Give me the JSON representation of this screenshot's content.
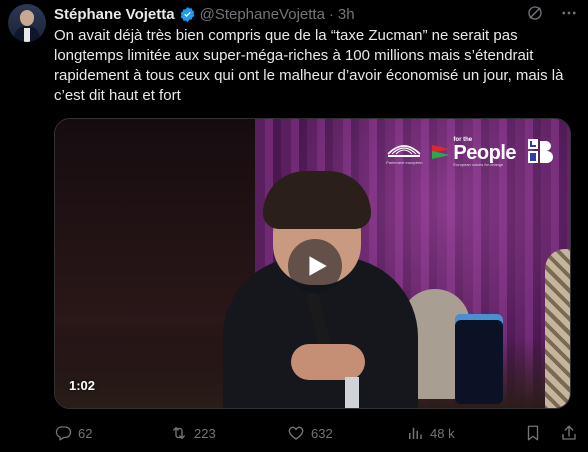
{
  "tweet": {
    "author": {
      "name": "Stéphane Vojetta",
      "handle": "@StephaneVojetta",
      "separator": "·",
      "time": "3h",
      "verified": true
    },
    "text": "On avait déjà très bien compris que de la “taxe Zucman” ne serait pas longtemps limitée aux super-méga-riches à 100 millions mais s’étendrait rapidement à tous ceux qui ont le malheur d’avoir économisé un jour, mais là c’est dit haut et fort",
    "media": {
      "type": "video",
      "duration": "1:02",
      "logos": {
        "ep_caption": "Parlement européen",
        "ftp_small": "for the",
        "ftp_big": "People",
        "ftp_sub": "European voices for change"
      }
    },
    "stats": {
      "replies": "62",
      "reposts": "223",
      "likes": "632",
      "views": "48 k"
    }
  },
  "icons": {
    "verified": "verified-badge-icon",
    "grok": "grok-icon",
    "more": "more-icon",
    "reply": "reply-icon",
    "repost": "repost-icon",
    "like": "heart-icon",
    "views": "views-icon",
    "bookmark": "bookmark-icon",
    "share": "share-icon",
    "play": "play-icon"
  },
  "colors": {
    "background": "#000000",
    "text": "#e7e9ea",
    "muted": "#71767b",
    "verified": "#1d9bf0"
  }
}
